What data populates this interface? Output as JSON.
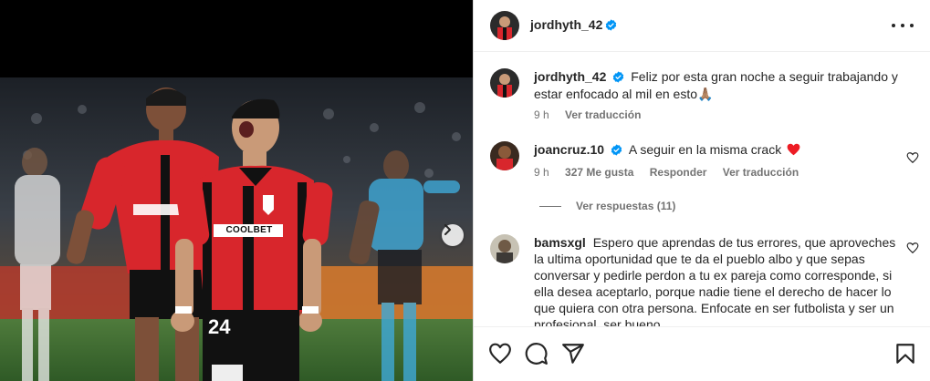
{
  "post": {
    "author": "jordhyth_42",
    "caption": "Feliz por esta gran noche a seguir trabajando y estar enfocado al mil en esto🙏🏽",
    "caption_time": "9 h",
    "caption_translate": "Ver traducción"
  },
  "comments": [
    {
      "username": "joancruz.10",
      "text": "A seguir en la misma crack",
      "time": "9 h",
      "likes": "327 Me gusta",
      "reply": "Responder",
      "translate": "Ver traducción",
      "view_replies": "Ver respuestas (11)"
    },
    {
      "username": "bamsxgl",
      "text": "Espero que aprendas de tus errores, que aproveches la ultima oportunidad que te da el pueblo albo y que sepas conversar y pedirle perdon a tu ex pareja como corresponde, si ella desea aceptarlo, porque nadie tiene el derecho de hacer lo que quiera con otra persona. Enfocate en ser futbolista y ser un profesional, ser bueno"
    }
  ],
  "photo": {
    "jersey_sponsor": "COOLBET",
    "jersey_number": "24"
  },
  "colors": {
    "verified": "#0095f6",
    "heart_red": "#ed4956",
    "jersey_red": "#d8262c",
    "text_secondary": "#737373"
  },
  "icons": [
    "verified-icon",
    "more-options-icon",
    "heart-icon",
    "like-icon",
    "comment-icon",
    "share-icon",
    "save-icon",
    "next-arrow-icon"
  ]
}
